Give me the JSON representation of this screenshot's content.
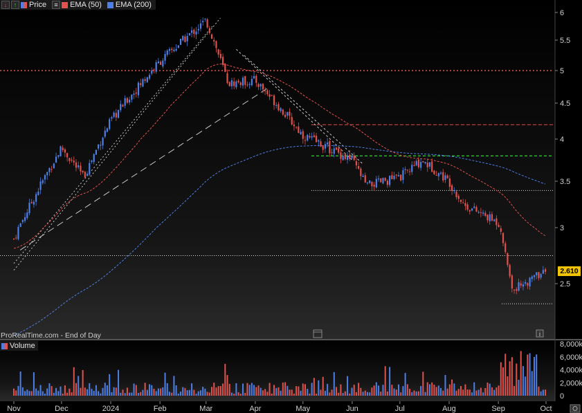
{
  "legend": {
    "items": [
      {
        "label": "Price",
        "color": "#d9413f"
      },
      {
        "label": "EMA (50)",
        "color": "#e0524e"
      },
      {
        "label": "EMA (200)",
        "color": "#4d7fe6"
      }
    ],
    "buttons": [
      "down-arrow-icon",
      "up-arrow-icon",
      "menu-icon"
    ]
  },
  "source_label": "ProRealTime.com - End of Day",
  "last_price_label": "2.610",
  "volume_legend": {
    "label": "Volume",
    "color": "#d9413f"
  },
  "colors": {
    "up": "#4d7fe6",
    "down": "#e0524e",
    "ema50": "#e0524e",
    "ema200": "#4d7fe6",
    "dashed_red": "#e0524e",
    "dashed_green": "#2fd62f",
    "dotted_white": "#dddddd"
  },
  "chart_data": [
    {
      "type": "candlestick",
      "ylim": [
        2.05,
        6.1
      ],
      "y_ticks": [
        "6",
        "5.5",
        "5",
        "4.5",
        "4",
        "3.5",
        "3",
        "2.5"
      ],
      "x_ticks": [
        "Nov",
        "Dec",
        "2024",
        "Feb",
        "Mar",
        "Apr",
        "May",
        "Jun",
        "Jul",
        "Aug",
        "Sep",
        "Oct"
      ],
      "grid": false,
      "last_close": 2.61,
      "approx_close_path": [
        {
          "date": "2023-11-01",
          "close": 2.9
        },
        {
          "date": "2023-12-01",
          "close": 3.9
        },
        {
          "date": "2023-12-15",
          "close": 3.55
        },
        {
          "date": "2024-01-01",
          "close": 4.25
        },
        {
          "date": "2024-02-01",
          "close": 5.15
        },
        {
          "date": "2024-03-01",
          "close": 5.85
        },
        {
          "date": "2024-03-15",
          "close": 4.8
        },
        {
          "date": "2024-04-01",
          "close": 4.85
        },
        {
          "date": "2024-05-01",
          "close": 4.05
        },
        {
          "date": "2024-06-01",
          "close": 3.75
        },
        {
          "date": "2024-06-10",
          "close": 3.45
        },
        {
          "date": "2024-07-01",
          "close": 3.55
        },
        {
          "date": "2024-07-15",
          "close": 3.75
        },
        {
          "date": "2024-08-01",
          "close": 3.5
        },
        {
          "date": "2024-08-10",
          "close": 3.25
        },
        {
          "date": "2024-09-01",
          "close": 3.05
        },
        {
          "date": "2024-09-10",
          "close": 2.45
        },
        {
          "date": "2024-10-01",
          "close": 2.61
        }
      ],
      "horizontal_levels": [
        {
          "value": 5.0,
          "style": "dotted-red"
        },
        {
          "value": 4.2,
          "style": "dashed-red"
        },
        {
          "value": 3.8,
          "style": "dashed-green"
        },
        {
          "value": 3.4,
          "style": "dotted-white"
        },
        {
          "value": 2.75,
          "style": "dotted-white"
        },
        {
          "value": 2.32,
          "style": "dotted-white"
        }
      ],
      "series": [
        {
          "name": "Price"
        },
        {
          "name": "EMA (50)"
        },
        {
          "name": "EMA (200)"
        }
      ]
    },
    {
      "type": "bar",
      "y_ticks": [
        "8,000k",
        "6,000k",
        "4,000k",
        "2,000k",
        "0"
      ],
      "ylim": [
        0,
        8000
      ],
      "series": [
        {
          "name": "Volume"
        }
      ]
    }
  ]
}
